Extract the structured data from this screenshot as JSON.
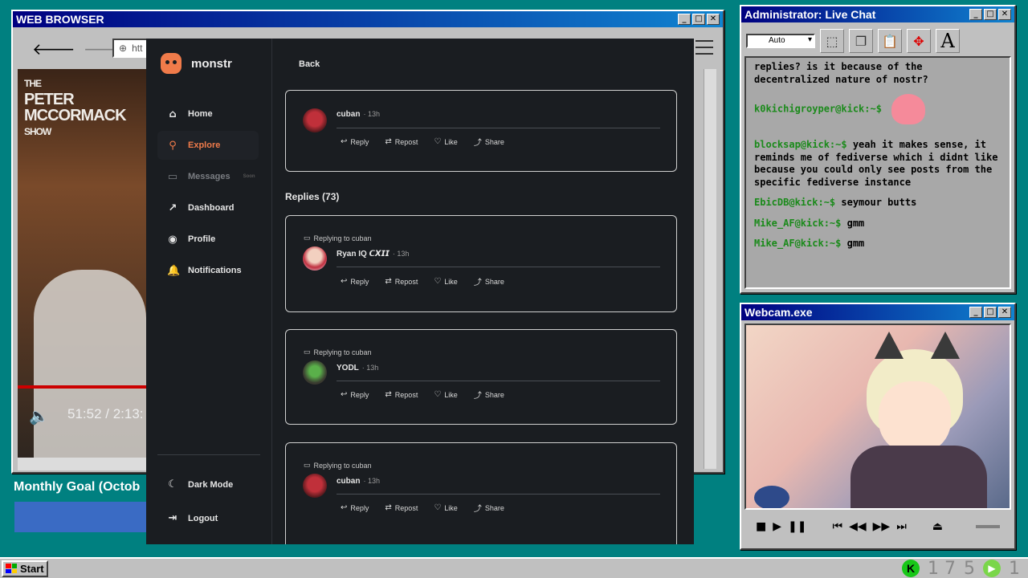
{
  "browser": {
    "title": "WEB BROWSER",
    "url_prefix": "htt",
    "video": {
      "show_title_line1": "THE",
      "show_title_line2": "PETER",
      "show_title_line3": "MCCORMACK",
      "show_title_line4": "SHOW",
      "time": "51:52 / 2:13:",
      "progress": 0.39
    },
    "monthly_goal": "Monthly Goal (Octob"
  },
  "app": {
    "name": "monstr",
    "nav": [
      {
        "label": "Home",
        "icon": "home-icon"
      },
      {
        "label": "Explore",
        "icon": "search-icon",
        "active": true
      },
      {
        "label": "Messages",
        "icon": "message-icon",
        "muted": true,
        "badge": "Soon"
      },
      {
        "label": "Dashboard",
        "icon": "trend-icon"
      },
      {
        "label": "Profile",
        "icon": "user-icon"
      },
      {
        "label": "Notifications",
        "icon": "bell-icon"
      }
    ],
    "dark_mode": "Dark Mode",
    "logout": "Logout",
    "back": "Back",
    "replies_heading": "Replies (73)",
    "actions": {
      "reply": "Reply",
      "repost": "Repost",
      "like": "Like",
      "share": "Share"
    },
    "main_post": {
      "author": "cuban",
      "time": "· 13h"
    },
    "replies": [
      {
        "replying_to": "Replying to cuban",
        "author": "Ryan IQ 𝘾𝙓𝙄𝙄",
        "time": "· 13h"
      },
      {
        "replying_to": "Replying to cuban",
        "author": "YODL",
        "time": "· 13h"
      },
      {
        "replying_to": "Replying to cuban",
        "author": "cuban",
        "time": "· 13h"
      }
    ]
  },
  "chat": {
    "title": "Administrator: Live Chat",
    "font_select": "Auto",
    "messages": [
      {
        "user": "",
        "text": "replies? is it because of the decentralized nature of nostr?"
      },
      {
        "user": "k0kichigroyper@kick:~$",
        "text": ""
      },
      {
        "user": "blocksap@kick:~$",
        "text": " yeah it makes sense, it reminds me of fediverse which i didnt like because you could only see posts from the specific fediverse instance"
      },
      {
        "user": "EbicDB@kick:~$",
        "text": " seymour butts"
      },
      {
        "user": "Mike_AF@kick:~$",
        "text": " gmm"
      },
      {
        "user": "Mike_AF@kick:~$",
        "text": " gmm"
      }
    ]
  },
  "webcam": {
    "title": "Webcam.exe"
  },
  "taskbar": {
    "start": "Start",
    "tray_a": "1 7",
    "tray_b": "5",
    "tray_c": "1"
  },
  "colors": {
    "desktop": "#008080",
    "accent": "#f07b4a",
    "titlebar": "#000080"
  }
}
